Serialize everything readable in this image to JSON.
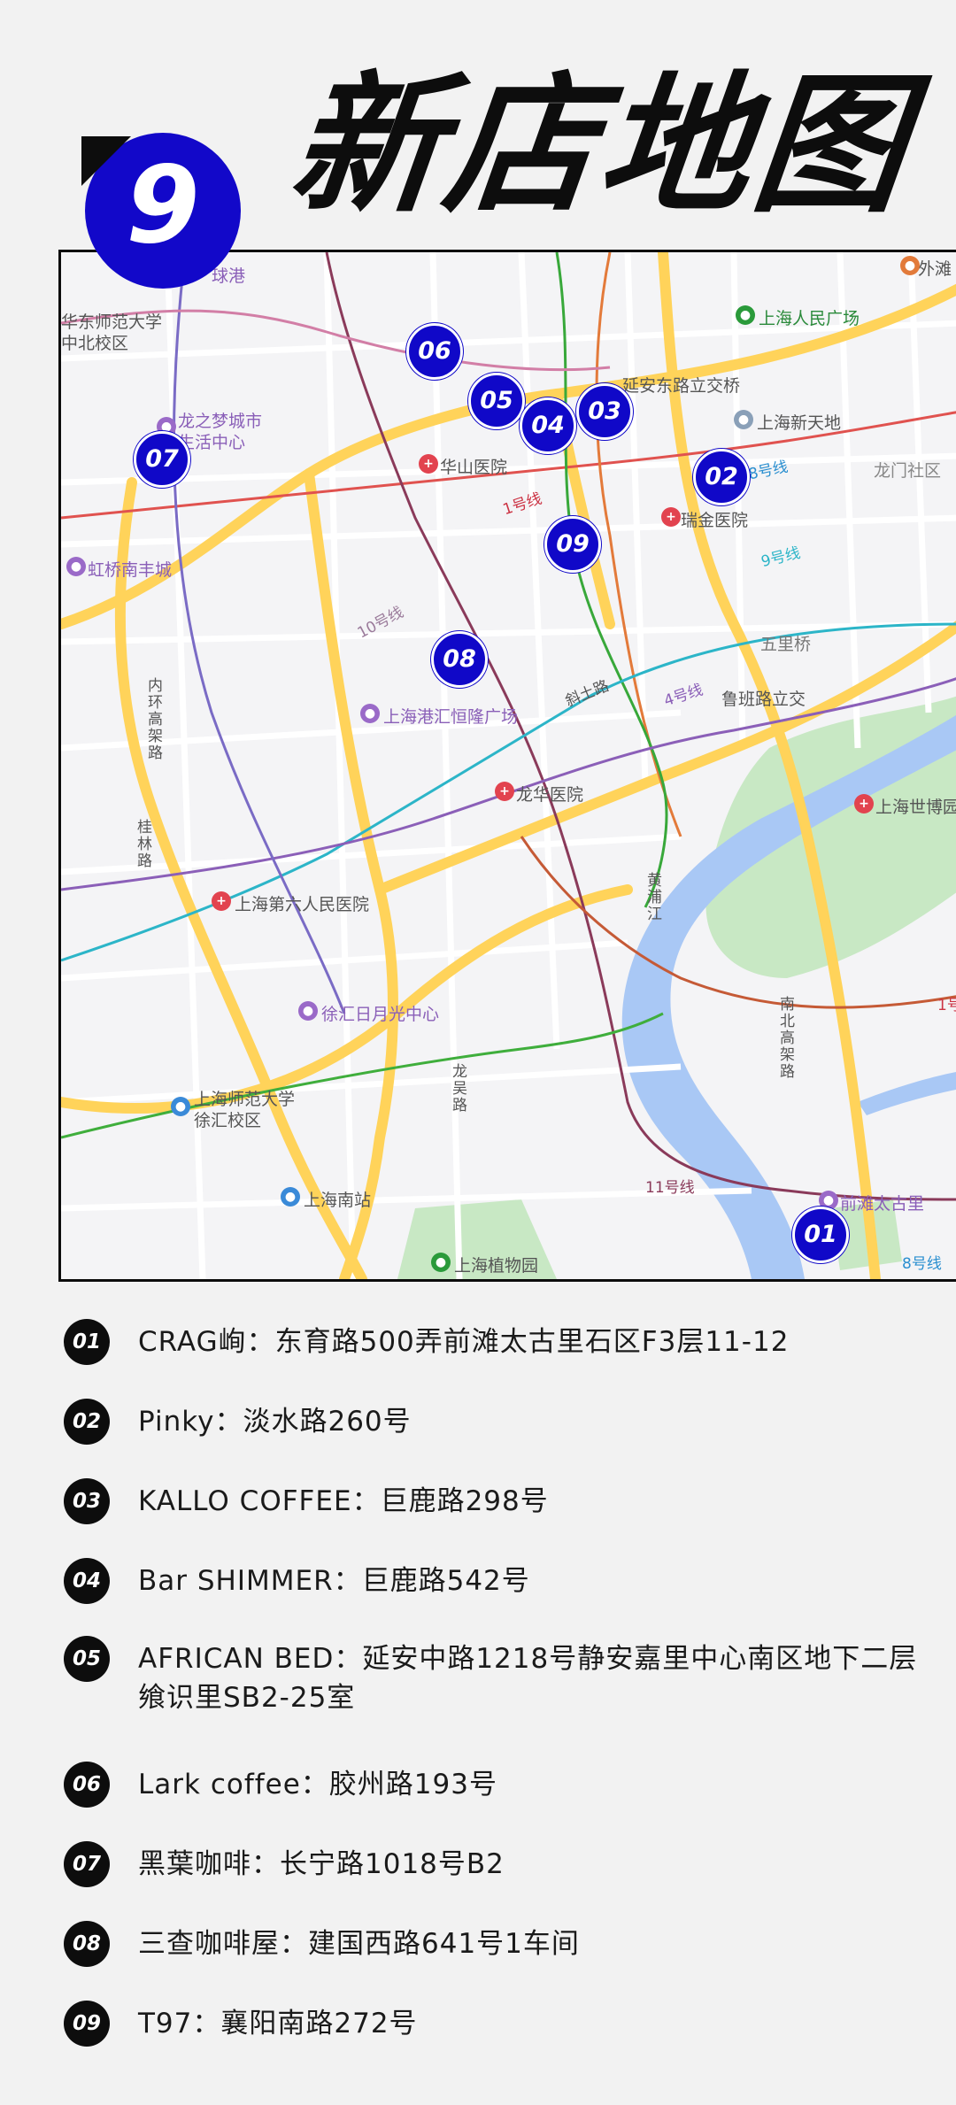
{
  "header": {
    "title": "新店地图",
    "badge_number": "9"
  },
  "map": {
    "place_labels": [
      "球港",
      "华东师范大学",
      "中北校区",
      "上海人民广场",
      "延安东路立交桥",
      "上海新天地",
      "龙门社区",
      "龙之梦城市",
      "生活中心",
      "华山医院",
      "瑞金医院",
      "虹桥南丰城",
      "五里桥",
      "鲁班路立交",
      "上海港汇恒隆广场",
      "龙华医院",
      "上海世博园",
      "上海第六人民医院",
      "徐汇日月光中心",
      "上海师范大学",
      "徐汇校区",
      "上海南站",
      "前滩太古里",
      "上海植物园",
      "外滩"
    ],
    "road_labels": [
      "内环高架路",
      "桂林路",
      "1号线",
      "10号线",
      "斜土路",
      "4号线",
      "9号线",
      "黄浦江",
      "南北高架路",
      "龙吴路",
      "11号线",
      "8号线",
      "8号线",
      "1号"
    ],
    "markers": [
      "01",
      "02",
      "03",
      "04",
      "05",
      "06",
      "07",
      "08",
      "09"
    ]
  },
  "stores": [
    {
      "num": "01",
      "text": "CRAG峋：东育路500弄前滩太古里石区F3层11-12"
    },
    {
      "num": "02",
      "text": "Pinky：淡水路260号"
    },
    {
      "num": "03",
      "text": "KALLO COFFEE：巨鹿路298号"
    },
    {
      "num": "04",
      "text": "Bar SHIMMER：巨鹿路542号"
    },
    {
      "num": "05",
      "text": "AFRICAN BED：延安中路1218号静安嘉里中心南区地下二层",
      "text2": "飨识里SB2-25室"
    },
    {
      "num": "06",
      "text": "Lark coffee：胶州路193号"
    },
    {
      "num": "07",
      "text": "黑葉咖啡：长宁路1018号B2"
    },
    {
      "num": "08",
      "text": "三查咖啡屋：建国西路641号1车间"
    },
    {
      "num": "09",
      "text": "T97：襄阳南路272号"
    }
  ],
  "colors": {
    "marker": "#1008c8",
    "badge": "#1208c9",
    "river": "#a9c8f5",
    "park": "#c8e8c4",
    "expressway": "#ffd35a"
  }
}
